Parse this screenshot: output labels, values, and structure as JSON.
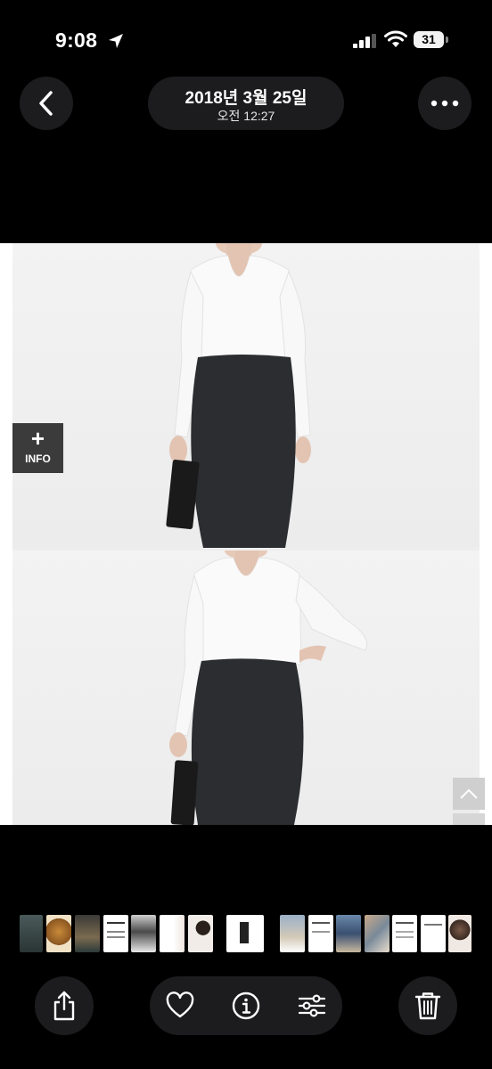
{
  "status_bar": {
    "time": "9:08",
    "battery": "31",
    "icons": [
      "location-arrow-icon",
      "cellular-signal-icon",
      "wifi-icon",
      "battery-icon"
    ]
  },
  "nav": {
    "back_icon": "chevron-left-icon",
    "date": "2018년 3월 25일",
    "time": "오전 12:27",
    "more_icon": "ellipsis-icon"
  },
  "photo": {
    "description_icon": "photo",
    "info_badge": {
      "plus": "+",
      "label": "INFO"
    },
    "scroll_icon": "chevron-up-icon"
  },
  "toolbar": {
    "share_icon": "share-icon",
    "favorite_icon": "heart-icon",
    "info_icon": "info-icon",
    "adjust_icon": "sliders-icon",
    "delete_icon": "trash-icon"
  },
  "colors": {
    "background": "#000000",
    "button_bg": "#1c1c1e",
    "text": "#ffffff"
  }
}
